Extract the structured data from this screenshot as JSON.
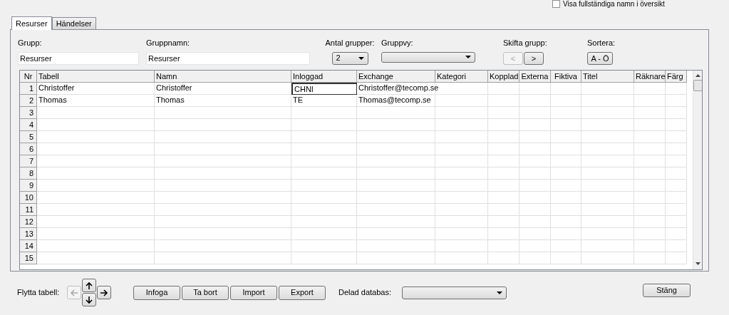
{
  "top_checkbox": {
    "label": "Visa fullständiga namn i översikt",
    "checked": false
  },
  "tabs": [
    {
      "label": "Resurser",
      "selected": true
    },
    {
      "label": "Händelser",
      "selected": false
    }
  ],
  "fields": {
    "grupp": {
      "label": "Grupp:",
      "value": "Resurser"
    },
    "gruppnamn": {
      "label": "Gruppnamn:",
      "value": "Resurser"
    },
    "antal_grupper": {
      "label": "Antal grupper:",
      "value": "2"
    },
    "gruppvy": {
      "label": "Gruppvy:"
    },
    "skifta_grupp": {
      "label": "Skifta grupp:",
      "prev": {
        "label": "<",
        "disabled": true
      },
      "next": {
        "label": ">",
        "disabled": false
      }
    },
    "sortera": {
      "label": "Sortera:",
      "button": "A - Ö"
    }
  },
  "table": {
    "columns": [
      "Nr",
      "Tabell",
      "Namn",
      "Inloggad",
      "Exchange",
      "Kategori",
      "Kopplad",
      "Externa",
      "Fiktiva",
      "Titel",
      "Räknare",
      "Färg"
    ],
    "rows": [
      {
        "cells": [
          {
            "text": "1",
            "focused": false
          },
          {
            "text": "Christoffer",
            "focused": false
          },
          {
            "text": "Christoffer",
            "focused": false
          },
          {
            "text": "CHNI",
            "focused": true
          },
          {
            "text": "Christoffer@tecomp.se",
            "focused": false
          },
          {
            "text": "",
            "focused": false
          },
          {
            "text": "",
            "focused": false
          },
          {
            "text": "",
            "focused": false
          },
          {
            "text": "",
            "focused": false
          },
          {
            "text": "",
            "focused": false
          },
          {
            "text": "",
            "focused": false
          },
          {
            "text": "",
            "focused": false
          }
        ]
      },
      {
        "cells": [
          {
            "text": "2",
            "focused": false
          },
          {
            "text": "Thomas",
            "focused": false
          },
          {
            "text": "Thomas",
            "focused": false
          },
          {
            "text": "TE",
            "focused": false
          },
          {
            "text": "Thomas@tecomp.se",
            "focused": false
          },
          {
            "text": "",
            "focused": false
          },
          {
            "text": "",
            "focused": false
          },
          {
            "text": "",
            "focused": false
          },
          {
            "text": "",
            "focused": false
          },
          {
            "text": "",
            "focused": false
          },
          {
            "text": "",
            "focused": false
          },
          {
            "text": "",
            "focused": false
          }
        ]
      },
      {
        "cells": [
          "3",
          "",
          "",
          "",
          "",
          "",
          "",
          "",
          "",
          "",
          "",
          ""
        ]
      },
      {
        "cells": [
          "4",
          "",
          "",
          "",
          "",
          "",
          "",
          "",
          "",
          "",
          "",
          ""
        ]
      },
      {
        "cells": [
          "5",
          "",
          "",
          "",
          "",
          "",
          "",
          "",
          "",
          "",
          "",
          ""
        ]
      },
      {
        "cells": [
          "6",
          "",
          "",
          "",
          "",
          "",
          "",
          "",
          "",
          "",
          "",
          ""
        ]
      },
      {
        "cells": [
          "7",
          "",
          "",
          "",
          "",
          "",
          "",
          "",
          "",
          "",
          "",
          ""
        ]
      },
      {
        "cells": [
          "8",
          "",
          "",
          "",
          "",
          "",
          "",
          "",
          "",
          "",
          "",
          ""
        ]
      },
      {
        "cells": [
          "9",
          "",
          "",
          "",
          "",
          "",
          "",
          "",
          "",
          "",
          "",
          ""
        ]
      },
      {
        "cells": [
          "10",
          "",
          "",
          "",
          "",
          "",
          "",
          "",
          "",
          "",
          "",
          ""
        ]
      },
      {
        "cells": [
          "11",
          "",
          "",
          "",
          "",
          "",
          "",
          "",
          "",
          "",
          "",
          ""
        ]
      },
      {
        "cells": [
          "12",
          "",
          "",
          "",
          "",
          "",
          "",
          "",
          "",
          "",
          "",
          ""
        ]
      },
      {
        "cells": [
          "13",
          "",
          "",
          "",
          "",
          "",
          "",
          "",
          "",
          "",
          "",
          ""
        ]
      },
      {
        "cells": [
          "14",
          "",
          "",
          "",
          "",
          "",
          "",
          "",
          "",
          "",
          "",
          ""
        ]
      },
      {
        "cells": [
          "15",
          "",
          "",
          "",
          "",
          "",
          "",
          "",
          "",
          "",
          "",
          ""
        ]
      }
    ]
  },
  "footer": {
    "flytta_label": "Flytta tabell:",
    "move": {
      "left_disabled": true,
      "up_disabled": false,
      "right_disabled": false,
      "down_disabled": false
    },
    "buttons": [
      "Infoga",
      "Ta bort",
      "Import",
      "Export"
    ],
    "delad_label": "Delad databas:",
    "close": "Stäng"
  }
}
